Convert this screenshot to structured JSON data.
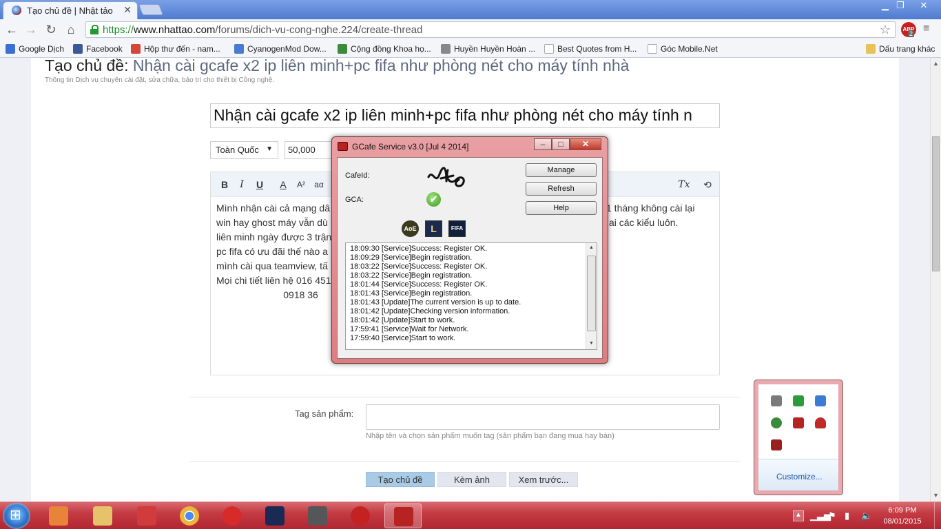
{
  "browser": {
    "tab_title": "Tạo chủ đề | Nhật tảo",
    "tab_close": "✕",
    "url_scheme": "https://",
    "url_host": "www.nhattao.com",
    "url_path": "/forums/dich-vu-cong-nghe.224/create-thread",
    "abp_label": "ABP",
    "abp_count": "2",
    "window_controls": {
      "minimize": "▁",
      "restore": "❐",
      "close": "✕"
    }
  },
  "bookmarks": [
    {
      "label": "Google Dịch",
      "color": "#3b6fd4"
    },
    {
      "label": "Facebook",
      "color": "#3b5998"
    },
    {
      "label": "Hộp thư đến - nam...",
      "color": "#d44638"
    },
    {
      "label": "CyanogenMod Dow...",
      "color": "#4a7bd0"
    },
    {
      "label": "Cộng đồng Khoa họ...",
      "color": "#3d8a3a"
    },
    {
      "label": "Huyền Huyền Hoàn ...",
      "color": "#888888"
    },
    {
      "label": "Best Quotes from H...",
      "color": "#dddddd"
    },
    {
      "label": "Góc Mobile.Net",
      "color": "#dddddd"
    }
  ],
  "other_bookmarks": "Dấu trang khác",
  "page": {
    "title_prefix": "Tạo chủ đề:",
    "title_thread": "Nhận cài gcafe x2 ip liên minh+pc fifa như phòng nét cho máy tính nhà",
    "subtitle": "Thông tin Dịch vụ chuyên cài đặt, sửa chữa, bảo trì cho thiết bị Công nghệ.",
    "title_input": "Nhận cài gcafe x2 ip liên minh+pc fifa như phòng nét cho máy tính n",
    "region": "Toàn Quốc",
    "price": "50,000",
    "editor_lines": [
      "Mình nhận cài cả mạng dâ",
      "win hay ghost máy vẫn dù",
      "liên minh ngày được 3 trận",
      "pc fifa có ưu đãi thế nào a",
      "mình cài qua teamview, tấ",
      "Mọi chi tiết liên hệ 016 451",
      "                         0918 36"
    ],
    "editor_right_lines": [
      "1 tháng không cài lại",
      "ai các kiểu luôn."
    ],
    "toolbar_buttons": {
      "bold": "B",
      "italic": "I",
      "underline": "U",
      "color": "A",
      "size": "A²",
      "font": "aα",
      "clear": "Tx",
      "source": "⟲"
    },
    "tag_label": "Tag sản phẩm:",
    "tag_hint": "Nhập tên và chọn sản phẩm muốn tag (sản phẩm bạn đang mua hay bán)",
    "btn_create": "Tạo chủ đề",
    "btn_attach": "Kèm ảnh",
    "btn_preview": "Xem trước..."
  },
  "gcafe": {
    "title": "GCafe Service v3.0 [Jul  4 2014]",
    "cafeid_label": "CafeId:",
    "gca_label": "GCA:",
    "gca_status": "✔",
    "btn_manage": "Manage",
    "btn_refresh": "Refresh",
    "btn_help": "Help",
    "games": [
      {
        "label": "AoE",
        "color": "#3b3b1a"
      },
      {
        "label": "L",
        "color": "#1c2a4e"
      },
      {
        "label": "FIFA",
        "color": "#10203a"
      }
    ],
    "log": [
      "18:09:30 [Service]Success: Register OK.",
      "18:09:29 [Service]Begin registration.",
      "18:03:22 [Service]Success: Register OK.",
      "18:03:22 [Service]Begin registration.",
      "18:01:44 [Service]Success: Register OK.",
      "18:01:43 [Service]Begin registration.",
      "18:01:43 [Update]The current version is up to date.",
      "18:01:42 [Update]Checking version information.",
      "18:01:42 [Update]Start to work.",
      "17:59:41 [Service]Wait for Network.",
      "17:59:40 [Service]Start to work."
    ]
  },
  "tray_flyout": {
    "customize": "Customize...",
    "icons": [
      {
        "name": "usb-icon",
        "color": "#7a7a7a"
      },
      {
        "name": "sync-icon",
        "color": "#2e9b3a"
      },
      {
        "name": "ie-icon",
        "color": "#3b7bd4"
      },
      {
        "name": "network-icon",
        "color": "#3a8a3a"
      },
      {
        "name": "gcafe-icon",
        "color": "#b72222"
      },
      {
        "name": "user-icon",
        "color": "#c02a2a"
      },
      {
        "name": "app-icon",
        "color": "#9a2020"
      }
    ]
  },
  "taskbar": {
    "apps": [
      {
        "name": "media-player",
        "color": "#e8833a"
      },
      {
        "name": "file-explorer",
        "color": "#e6c36a"
      },
      {
        "name": "unikey",
        "color": "#d13b3b"
      },
      {
        "name": "chrome",
        "color": "#e9b63b"
      },
      {
        "name": "app-3",
        "color": "#d72b2b"
      },
      {
        "name": "league-of-legends",
        "color": "#1a2a55"
      },
      {
        "name": "warrior",
        "color": "#55555a"
      },
      {
        "name": "red-user",
        "color": "#c42222"
      },
      {
        "name": "gcafe",
        "color": "#b72222"
      }
    ],
    "tray_arrow": "▲",
    "time": "6:09 PM",
    "date": "08/01/2015"
  }
}
